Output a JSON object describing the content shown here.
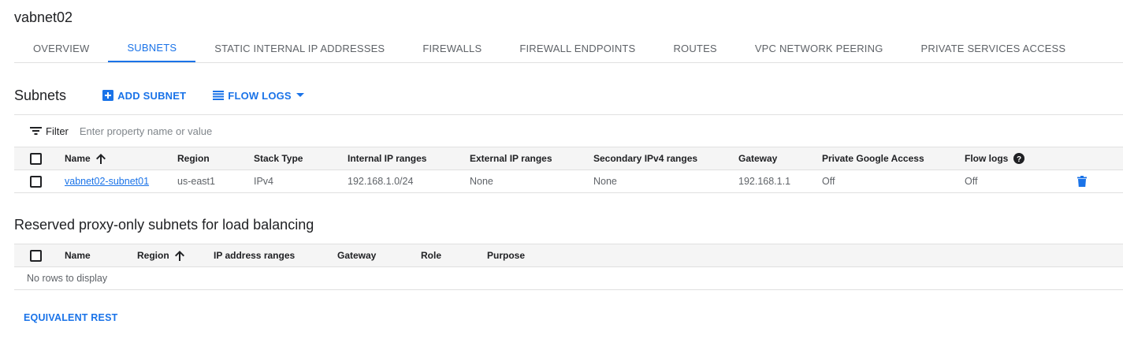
{
  "page": {
    "title": "vabnet02"
  },
  "tabs": [
    {
      "label": "OVERVIEW"
    },
    {
      "label": "SUBNETS",
      "active": true
    },
    {
      "label": "STATIC INTERNAL IP ADDRESSES"
    },
    {
      "label": "FIREWALLS"
    },
    {
      "label": "FIREWALL ENDPOINTS"
    },
    {
      "label": "ROUTES"
    },
    {
      "label": "VPC NETWORK PEERING"
    },
    {
      "label": "PRIVATE SERVICES ACCESS"
    }
  ],
  "subnets": {
    "title": "Subnets",
    "add_label": "ADD SUBNET",
    "flow_logs_label": "FLOW LOGS",
    "filter_label": "Filter",
    "filter_placeholder": "Enter property name or value",
    "columns": [
      "Name",
      "Region",
      "Stack Type",
      "Internal IP ranges",
      "External IP ranges",
      "Secondary IPv4 ranges",
      "Gateway",
      "Private Google Access",
      "Flow logs"
    ],
    "rows": [
      {
        "name": "vabnet02-subnet01",
        "region": "us-east1",
        "stack_type": "IPv4",
        "internal_ip": "192.168.1.0/24",
        "external_ip": "None",
        "secondary": "None",
        "gateway": "192.168.1.1",
        "private_access": "Off",
        "flow_logs": "Off"
      }
    ]
  },
  "proxy": {
    "title": "Reserved proxy-only subnets for load balancing",
    "columns": [
      "Name",
      "Region",
      "IP address ranges",
      "Gateway",
      "Role",
      "Purpose"
    ],
    "empty_text": "No rows to display"
  },
  "footer": {
    "rest_label": "EQUIVALENT REST"
  },
  "colors": {
    "accent": "#1a73e8",
    "text": "#202124",
    "muted": "#5f6368",
    "delete": "#1a73e8"
  },
  "icons": {
    "add": "add-box-icon",
    "flow_logs": "list-lines-icon",
    "caret": "caret-down-icon",
    "filter": "filter-lines-icon",
    "sort": "arrow-up-icon",
    "help": "help-circle-icon",
    "delete": "trash-icon"
  }
}
